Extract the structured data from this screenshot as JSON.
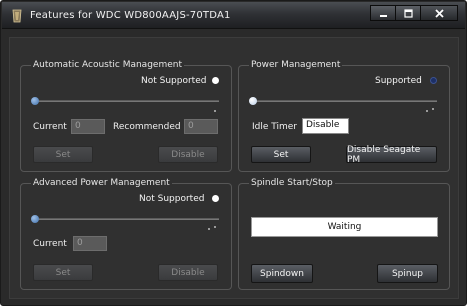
{
  "window": {
    "title": "Features for WDC WD800AAJS-70TDA1",
    "controls": {
      "minimize": "minimize",
      "maximize": "maximize",
      "close": "close"
    }
  },
  "aam": {
    "title": "Automatic Acoustic Management",
    "status": "Not Supported",
    "current_label": "Current",
    "current_value": "0",
    "recommended_label": "Recommended",
    "recommended_value": "0",
    "set_label": "Set",
    "disable_label": "Disable",
    "slider_level": 0
  },
  "power": {
    "title": "Power Management",
    "status": "Supported",
    "idle_timer_label": "Idle Timer",
    "idle_timer_value": "Disable",
    "set_label": "Set",
    "disable_pm_label": "Disable Seagate PM",
    "slider_level": 0
  },
  "apm": {
    "title": "Advanced Power Management",
    "status": "Not Supported",
    "current_label": "Current",
    "current_value": "0",
    "set_label": "Set",
    "disable_label": "Disable",
    "slider_level": 0
  },
  "spindle": {
    "title": "Spindle Start/Stop",
    "status_text": "Waiting",
    "spindown_label": "Spindown",
    "spinup_label": "Spinup"
  },
  "colors": {
    "status_dot_white": "#ffffff",
    "status_dot_blue": "#1c2f66",
    "window_bg": "#303030"
  }
}
